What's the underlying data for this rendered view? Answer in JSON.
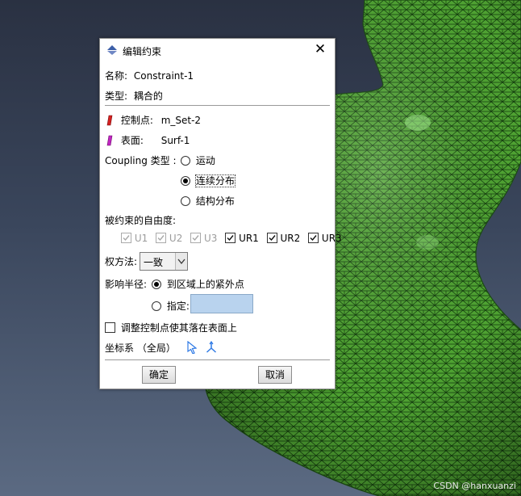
{
  "dialog": {
    "title": "编辑约束",
    "name_label": "名称:",
    "name_value": "Constraint-1",
    "type_label": "类型:",
    "type_value": "耦合的",
    "control_point_label": "控制点:",
    "control_point_value": "m_Set-2",
    "surface_label": "表面:",
    "surface_value": "Surf-1",
    "coupling_type_label": "Coupling 类型 :",
    "coupling_options": [
      "运动",
      "连续分布",
      "结构分布"
    ],
    "coupling_selected": "连续分布",
    "dof_label": "被约束的自由度:",
    "dof": [
      {
        "label": "U1",
        "checked": true,
        "enabled": false
      },
      {
        "label": "U2",
        "checked": true,
        "enabled": false
      },
      {
        "label": "U3",
        "checked": true,
        "enabled": false
      },
      {
        "label": "UR1",
        "checked": true,
        "enabled": true
      },
      {
        "label": "UR2",
        "checked": true,
        "enabled": true
      },
      {
        "label": "UR3",
        "checked": true,
        "enabled": true
      }
    ],
    "weight_label": "权方法:",
    "weight_value": "一致",
    "radius_label": "影响半径:",
    "radius_option_1": "到区域上的紧外点",
    "radius_option_2": "指定:",
    "radius_specified_value": "",
    "adjust_label": "调整控制点使其落在表面上",
    "adjust_checked": false,
    "csys_label": "坐标系 （全局）",
    "ok_label": "确定",
    "cancel_label": "取消"
  },
  "watermark": "CSDN @hanxuanzi",
  "colors": {
    "mesh_fill": "#4fa332",
    "mesh_line": "#123a0d",
    "accent_blue": "#2f7ae5",
    "control_point_icon": "#d42020",
    "surface_icon": "#c025c0",
    "input_bg": "#b9d3ee"
  }
}
